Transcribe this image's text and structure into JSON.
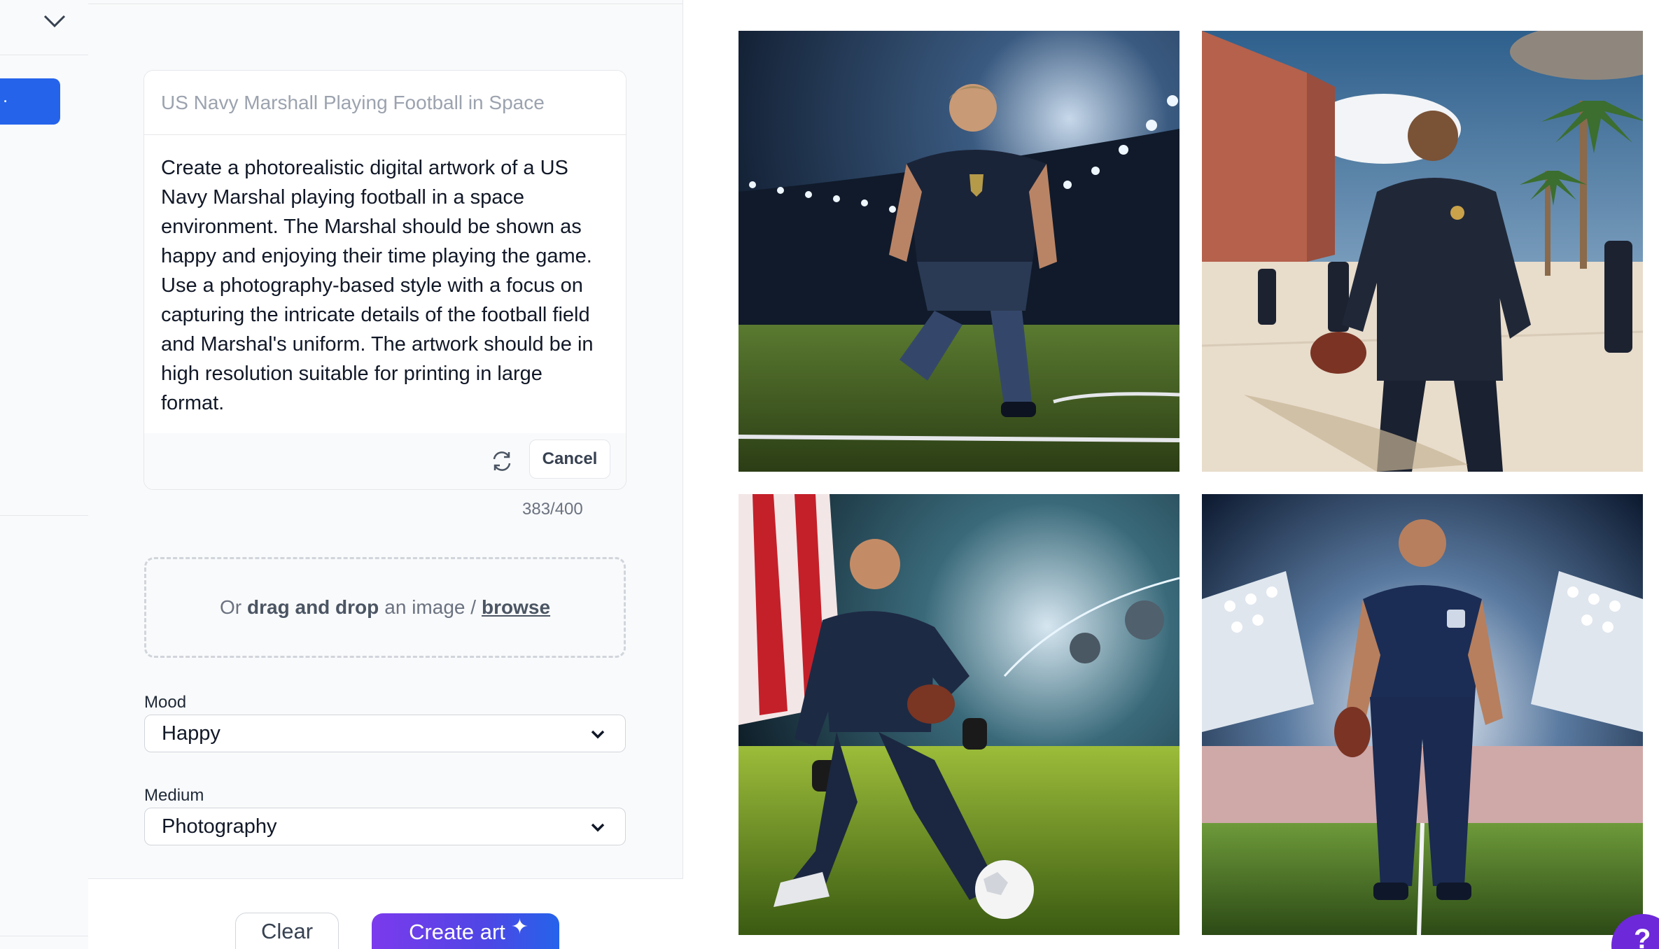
{
  "sidebar": {
    "collapse_icon": "chevron-down-icon",
    "active_item_label": ".",
    "accent": "#2563eb"
  },
  "prompt": {
    "title_placeholder": "US Navy Marshall Playing Football in Space",
    "text": "Create a photorealistic digital artwork of a US Navy Marshal playing football in a space environment. The Marshal should be shown as happy and enjoying their time playing the game. Use a photography-based style with a focus on capturing the intricate details of the football field and Marshal's uniform. The artwork should be in high resolution suitable for printing in large format.",
    "refresh_icon": "refresh-icon",
    "cancel_label": "Cancel",
    "char_count": "383/400"
  },
  "upload": {
    "prefix": "Or",
    "drag_text": "drag and drop",
    "middle": "an image /",
    "browse_label": "browse"
  },
  "mood": {
    "label": "Mood",
    "value": "Happy"
  },
  "medium": {
    "label": "Medium",
    "value": "Photography"
  },
  "actions": {
    "clear_label": "Clear",
    "create_label": "Create art",
    "create_icon": "sparkle-icon",
    "create_gradient": [
      "#7c3aed",
      "#2563eb"
    ]
  },
  "help": {
    "label": "?",
    "color": "#6d28d9"
  },
  "results": [
    {
      "scene": "marshal-kneeling-stadium-night"
    },
    {
      "scene": "marshal-uniform-palm-trees"
    },
    {
      "scene": "marshal-kneeling-flag-space"
    },
    {
      "scene": "marshal-standing-stadium-lights"
    }
  ]
}
